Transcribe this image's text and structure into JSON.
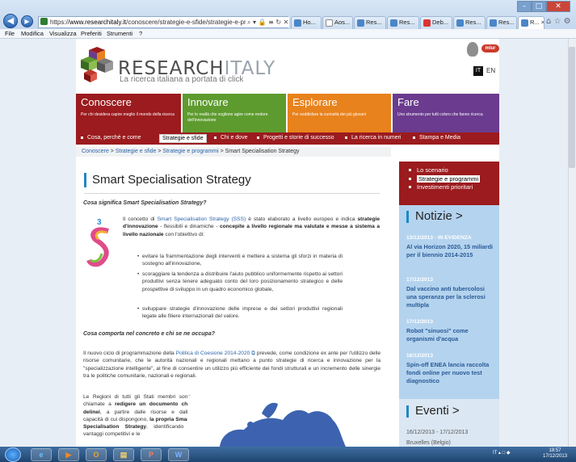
{
  "browser": {
    "url_scheme": "https://",
    "url_domain": "www.researchitaly.it",
    "url_path": "/conoscere/strategie-e-sfide/strategie-e-programmi/s",
    "addr_tools": "⌕ ▾ 🔒 ≡ ↻ ✕",
    "tabs": [
      "Ho...",
      "Aos...",
      "Res...",
      "Res...",
      "Deb...",
      "Res...",
      "Res...",
      "R..."
    ],
    "active_tab_close": "×",
    "icons": "⌂ ☆ ⚙",
    "win_min": "–",
    "win_max": "□",
    "win_close": "✕",
    "back_icon": "◀",
    "forward_icon": "▶"
  },
  "menubar": [
    "File",
    "Modifica",
    "Visualizza",
    "Preferiti",
    "Strumenti",
    "?"
  ],
  "header": {
    "logo_main": "RESEARCH",
    "logo_it": "ITALY",
    "tagline": "La ricerca italiana a portata di click",
    "miur": "miur",
    "lang_it": "IT",
    "lang_en": "EN"
  },
  "sections": [
    {
      "title": "Conoscere",
      "desc": "Per chi desidera capire meglio il mondo della ricerca",
      "color": "#9b1b1e"
    },
    {
      "title": "Innovare",
      "desc": "Per le realtà che vogliono agire come motore dell'innovazione",
      "color": "#5e9b2f"
    },
    {
      "title": "Esplorare",
      "desc": "Per soddisfare la curiosità dei più giovani",
      "color": "#e8821c"
    },
    {
      "title": "Fare",
      "desc": "Uno strumento per tutti coloro che fanno ricerca",
      "color": "#6a3b8e"
    }
  ],
  "nav": [
    "Cosa, perché e come",
    "Strategie e sfide",
    "Chi e dove",
    "Progetti e storie di successo",
    "La ricerca in numeri",
    "Stampa e Media"
  ],
  "breadcrumb": {
    "items": [
      "Conoscere",
      "Strategie e sfide",
      "Strategie e programmi"
    ],
    "sep": " > ",
    "current": "Smart Specialisation Strategy"
  },
  "main": {
    "title": "Smart Specialisation Strategy",
    "q1": "Cosa significa Smart Specialisation Strategy?",
    "p1_a": "Il concetto di ",
    "p1_link": "Smart Specialisation Strategy (SSS)",
    "p1_b": " è stato elaborato a livello europeo e indica ",
    "p1_bold1": "strategie d'innovazione",
    "p1_c": " - flessibili e dinamiche - ",
    "p1_bold2": "concepite a livello regionale ma valutate e messe a sistema a livello nazionale",
    "p1_d": " con l'obiettivo di:",
    "bullets": [
      "evitare la frammentazione degli interventi e mettere a sistema gli sforzi in materia di sostegno all'innovazione,",
      "scoraggiare la tendenza a distribuire l'aiuto pubblico uniformemente rispetto ai settori produttivi senza tenere adeguato conto del loro posizionamento strategico e delle prospettive di sviluppo in un quadro economico globale,",
      "sviluppare strategie d'innovazione delle imprese e dei settori produttivi regionali legate alle filiere internazionali del valore."
    ],
    "bullet_dot": "•",
    "q2": "Cosa comporta nel concreto e chi se ne occupa?",
    "p2_a": "Il nuovo ciclo di programmazione della ",
    "p2_link": "Politica di Coesione 2014-2020",
    "p2_ext": " ⧉",
    "p2_b": " prevede, come condizione ex ante per l'utilizzo delle risorse comunitarie, che le autorità nazionali e regionali mettano a punto strategie di ricerca e innovazione per la \"specializzazione intelligente\", al fine di consentire un utilizzo più efficiente dei fondi strutturali e un incremento delle sinergie tra le politiche comunitarie, nazionali e regionali.",
    "p3_a": "Le Regioni di tutti gli Stati membri sono chiamate a ",
    "p3_bold1": "redigere un documento che delinei",
    "p3_b": ", a partire dalle risorse e dalle capacità di cui dispongono, ",
    "p3_bold2": "la propria Smart Specialisation Strategy",
    "p3_c": ", identificando i vantaggi competitivi e le"
  },
  "sidebar": {
    "items": [
      "Lo scenario",
      "Strategie e programmi",
      "Investimenti prioritari"
    ],
    "notizie_title": "Notizie >",
    "news": [
      {
        "date": "13/12/2013 - IN EVIDENZA",
        "title": "Al via Horizon 2020, 15 miliardi per il biennio 2014-2015"
      },
      {
        "date": "17/12/2013",
        "title": "Dal vaccino anti tubercolosi una speranza per la sclerosi multipla"
      },
      {
        "date": "17/12/2013",
        "title": "Robot \"sinuosi\" come organismi d'acqua"
      },
      {
        "date": "16/12/2013",
        "title": "Spin-off ENEA lancia raccolta fondi online per nuovo test diagnostico"
      }
    ],
    "eventi_title": "Eventi >",
    "event_date": "16/12/2013 - 17/12/2013",
    "event_place": "Bruxelles (Belgio)"
  },
  "taskbar": {
    "apps": [
      "e",
      "▶",
      "O",
      "▤",
      "P",
      "W"
    ],
    "tray": "IT  ▴ □ ◆",
    "time": "18:57",
    "date": "17/12/2013"
  }
}
